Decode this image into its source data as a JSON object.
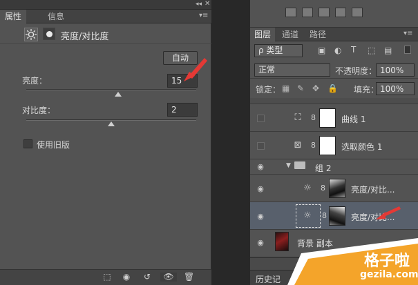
{
  "properties": {
    "tabs": [
      {
        "label": "属性"
      },
      {
        "label": "信息"
      }
    ],
    "header_title": "亮度/对比度",
    "auto_label": "自动",
    "brightness": {
      "label": "亮度：",
      "value": "15",
      "slider": 0.53
    },
    "contrast": {
      "label": "对比度：",
      "value": "2",
      "slider": 0.5
    },
    "legacy_label": "使用旧版"
  },
  "layers_panel": {
    "tabs": [
      {
        "label": "图层"
      },
      {
        "label": "通道"
      },
      {
        "label": "路径"
      }
    ],
    "filter_label": "ρ 类型",
    "blend_mode": "正常",
    "opacity_label": "不透明度：",
    "opacity_value": "100%",
    "lock_label": "锁定：",
    "fill_label": "填充：",
    "fill_value": "100%",
    "group_name": "组 2",
    "layers": [
      {
        "name": "曲线 1"
      },
      {
        "name": "选取颜色 1"
      },
      {
        "name": "亮度/对比..."
      },
      {
        "name": "亮度/对比..."
      },
      {
        "name": "背景 副本"
      }
    ],
    "history_label": "历史记"
  },
  "watermark": {
    "text_cn": "格子啦",
    "text_en": "gezila.com"
  },
  "colors": {
    "panel": "#535353",
    "dark": "#282828",
    "selected": "#58606c",
    "arrow": "#e53935"
  }
}
